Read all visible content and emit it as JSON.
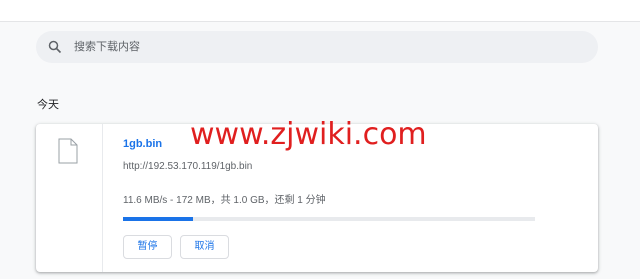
{
  "search": {
    "placeholder": "搜索下载内容",
    "icon": "search-icon"
  },
  "section": {
    "title": "今天"
  },
  "download": {
    "filename": "1gb.bin",
    "url": "http://192.53.170.119/1gb.bin",
    "status": "11.6 MB/s - 172 MB，共 1.0 GB，还剩 1 分钟",
    "progress": 0.17,
    "pause_label": "暂停",
    "cancel_label": "取消",
    "icon": "file-icon"
  },
  "watermark": {
    "text": "www.zjwiki.com"
  },
  "colors": {
    "accent": "#1a73e8",
    "watermark": "#e01f1f"
  }
}
